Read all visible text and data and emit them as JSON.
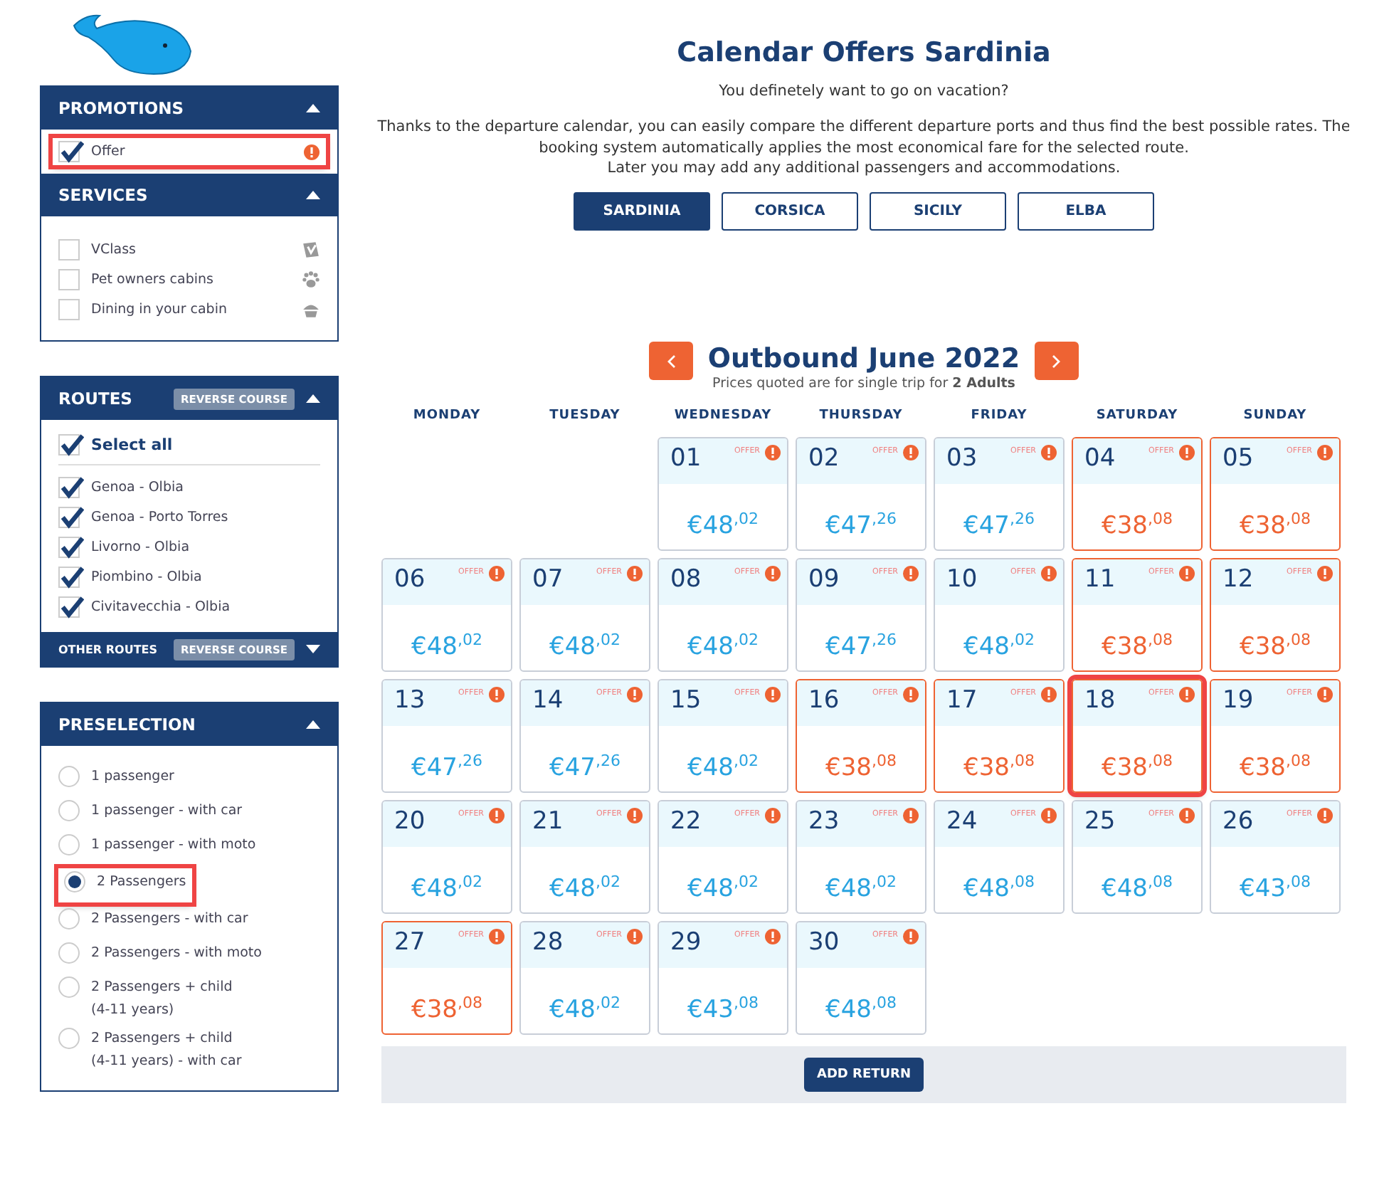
{
  "sidebar": {
    "promotions": {
      "title": "PROMOTIONS",
      "expanded": true,
      "items": [
        {
          "label": "Offer",
          "checked": true,
          "highlighted": true
        }
      ]
    },
    "services": {
      "title": "SERVICES",
      "expanded": true,
      "items": [
        {
          "label": "VClass",
          "checked": false,
          "kind": "vclass"
        },
        {
          "label": "Pet owners cabins",
          "checked": false,
          "kind": "paw"
        },
        {
          "label": "Dining in your cabin",
          "checked": false,
          "kind": "dining"
        }
      ]
    },
    "routes": {
      "title": "ROUTES",
      "reverse_button": "REVERSE COURSE",
      "expanded": true,
      "select_all": {
        "label": "Select all",
        "checked": true
      },
      "items": [
        {
          "label": "Genoa - Olbia",
          "checked": true
        },
        {
          "label": "Genoa - Porto Torres",
          "checked": true
        },
        {
          "label": "Livorno - Olbia",
          "checked": true
        },
        {
          "label": "Piombino - Olbia",
          "checked": true
        },
        {
          "label": "Civitavecchia - Olbia",
          "checked": true
        }
      ],
      "other": {
        "title": "OTHER ROUTES",
        "reverse_button": "REVERSE COURSE",
        "expanded": false
      }
    },
    "preselection": {
      "title": "PRESELECTION",
      "expanded": true,
      "items": [
        {
          "label": "1 passenger",
          "selected": false,
          "highlighted": false
        },
        {
          "label": "1 passenger - with car",
          "selected": false,
          "highlighted": false
        },
        {
          "label": "1 passenger - with moto",
          "selected": false,
          "highlighted": false
        },
        {
          "label": "2 Passengers",
          "selected": true,
          "highlighted": true
        },
        {
          "label": "2 Passengers - with car",
          "selected": false,
          "highlighted": false
        },
        {
          "label": "2 Passengers - with moto",
          "selected": false,
          "highlighted": false
        },
        {
          "label": "2 Passengers + child\n(4-11 years)",
          "selected": false,
          "highlighted": false
        },
        {
          "label": "2 Passengers + child\n(4-11 years) - with car",
          "selected": false,
          "highlighted": false
        }
      ]
    }
  },
  "main": {
    "title": "Calendar Offers Sardinia",
    "subtitle": "You definetely want to go on vacation?",
    "intro": "Thanks to the departure calendar, you can easily compare the different departure ports and thus find the best possible rates. The booking system automatically applies the most economical fare for the selected route.\nLater you may add any additional passengers and accommodations.",
    "tabs": [
      {
        "label": "SARDINIA",
        "selected": true
      },
      {
        "label": "CORSICA",
        "selected": false
      },
      {
        "label": "SICILY",
        "selected": false
      },
      {
        "label": "ELBA",
        "selected": false
      }
    ],
    "calendar": {
      "title": "Outbound June 2022",
      "note": "Prices quoted are for single trip for **2 Adults**",
      "weekdays": [
        "MONDAY",
        "TUESDAY",
        "WEDNESDAY",
        "THURSDAY",
        "FRIDAY",
        "SATURDAY",
        "SUNDAY"
      ],
      "weeks": [
        [
          {
            "kind": "blank"
          },
          {
            "kind": "blank"
          },
          {
            "day": "01",
            "offer": "OFFER",
            "price": "€48$^{,02}$",
            "cheapest": false,
            "highlighted": false
          },
          {
            "day": "02",
            "offer": "OFFER",
            "price": "€47$^{,26}$",
            "cheapest": false,
            "highlighted": false
          },
          {
            "day": "03",
            "offer": "OFFER",
            "price": "€47$^{,26}$",
            "cheapest": false,
            "highlighted": false
          },
          {
            "day": "04",
            "offer": "OFFER",
            "price": "€38$^{,08}$",
            "cheapest": true,
            "highlighted": false
          },
          {
            "day": "05",
            "offer": "OFFER",
            "price": "€38$^{,08}$",
            "cheapest": true,
            "highlighted": false
          }
        ],
        [
          {
            "day": "06",
            "offer": "OFFER",
            "price": "€48$^{,02}$",
            "cheapest": false,
            "highlighted": false
          },
          {
            "day": "07",
            "offer": "OFFER",
            "price": "€48$^{,02}$",
            "cheapest": false,
            "highlighted": false
          },
          {
            "day": "08",
            "offer": "OFFER",
            "price": "€48$^{,02}$",
            "cheapest": false,
            "highlighted": false
          },
          {
            "day": "09",
            "offer": "OFFER",
            "price": "€47$^{,26}$",
            "cheapest": false,
            "highlighted": false
          },
          {
            "day": "10",
            "offer": "OFFER",
            "price": "€48$^{,02}$",
            "cheapest": false,
            "highlighted": false
          },
          {
            "day": "11",
            "offer": "OFFER",
            "price": "€38$^{,08}$",
            "cheapest": true,
            "highlighted": false
          },
          {
            "day": "12",
            "offer": "OFFER",
            "price": "€38$^{,08}$",
            "cheapest": true,
            "highlighted": false
          }
        ],
        [
          {
            "day": "13",
            "offer": "OFFER",
            "price": "€47$^{,26}$",
            "cheapest": false,
            "highlighted": false
          },
          {
            "day": "14",
            "offer": "OFFER",
            "price": "€47$^{,26}$",
            "cheapest": false,
            "highlighted": false
          },
          {
            "day": "15",
            "offer": "OFFER",
            "price": "€48$^{,02}$",
            "cheapest": false,
            "highlighted": false
          },
          {
            "day": "16",
            "offer": "OFFER",
            "price": "€38$^{,08}$",
            "cheapest": true,
            "highlighted": false
          },
          {
            "day": "17",
            "offer": "OFFER",
            "price": "€38$^{,08}$",
            "cheapest": true,
            "highlighted": false
          },
          {
            "day": "18",
            "offer": "OFFER",
            "price": "€38$^{,08}$",
            "cheapest": true,
            "highlighted": true
          },
          {
            "day": "19",
            "offer": "OFFER",
            "price": "€38$^{,08}$",
            "cheapest": true,
            "highlighted": false
          }
        ],
        [
          {
            "day": "20",
            "offer": "OFFER",
            "price": "€48$^{,02}$",
            "cheapest": false,
            "highlighted": false
          },
          {
            "day": "21",
            "offer": "OFFER",
            "price": "€48$^{,02}$",
            "cheapest": false,
            "highlighted": false
          },
          {
            "day": "22",
            "offer": "OFFER",
            "price": "€48$^{,02}$",
            "cheapest": false,
            "highlighted": false
          },
          {
            "day": "23",
            "offer": "OFFER",
            "price": "€48$^{,02}$",
            "cheapest": false,
            "highlighted": false
          },
          {
            "day": "24",
            "offer": "OFFER",
            "price": "€48$^{,08}$",
            "cheapest": false,
            "highlighted": false
          },
          {
            "day": "25",
            "offer": "OFFER",
            "price": "€48$^{,08}$",
            "cheapest": false,
            "highlighted": false
          },
          {
            "day": "26",
            "offer": "OFFER",
            "price": "€43$^{,08}$",
            "cheapest": false,
            "highlighted": false
          }
        ],
        [
          {
            "day": "27",
            "offer": "OFFER",
            "price": "€38$^{,08}$",
            "cheapest": true,
            "highlighted": false
          },
          {
            "day": "28",
            "offer": "OFFER",
            "price": "€48$^{,02}$",
            "cheapest": false,
            "highlighted": false
          },
          {
            "day": "29",
            "offer": "OFFER",
            "price": "€43$^{,08}$",
            "cheapest": false,
            "highlighted": false
          },
          {
            "day": "30",
            "offer": "OFFER",
            "price": "€48$^{,08}$",
            "cheapest": false,
            "highlighted": false
          },
          {
            "kind": "blank"
          },
          {
            "kind": "blank"
          },
          {
            "kind": "blank"
          }
        ]
      ],
      "add_return": "ADD RETURN"
    }
  }
}
